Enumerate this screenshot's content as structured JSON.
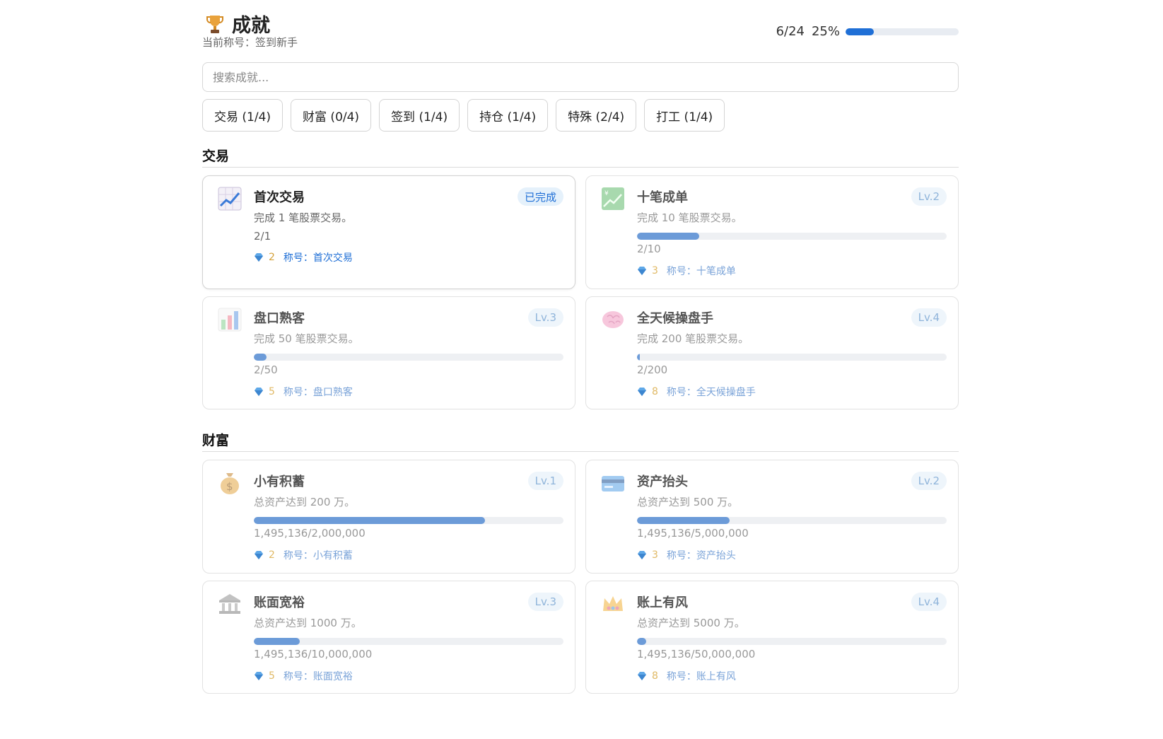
{
  "header": {
    "title": "成就",
    "current_title": "当前称号：签到新手",
    "progress_count": "6/24",
    "progress_percent": "25%",
    "progress_fraction": 0.25
  },
  "search": {
    "placeholder": "搜索成就..."
  },
  "filters": [
    {
      "label": "交易 (1/4)"
    },
    {
      "label": "财富 (0/4)"
    },
    {
      "label": "签到 (1/4)"
    },
    {
      "label": "持仓 (1/4)"
    },
    {
      "label": "特殊 (2/4)"
    },
    {
      "label": "打工 (1/4)"
    }
  ],
  "sections": [
    {
      "title": "交易",
      "cards": [
        {
          "icon": "chart-increasing-icon",
          "name": "首次交易",
          "badge": "已完成",
          "desc": "完成 1 笔股票交易。",
          "progress": "2/1",
          "fraction": 1,
          "reward": "2",
          "reward_title": "称号：首次交易",
          "completed": true
        },
        {
          "icon": "yen-chart-icon",
          "name": "十笔成单",
          "badge": "Lv.2",
          "desc": "完成 10 笔股票交易。",
          "progress": "2/10",
          "fraction": 0.2,
          "reward": "3",
          "reward_title": "称号：十笔成单",
          "completed": false
        },
        {
          "icon": "bar-chart-icon",
          "name": "盘口熟客",
          "badge": "Lv.3",
          "desc": "完成 50 笔股票交易。",
          "progress": "2/50",
          "fraction": 0.04,
          "reward": "5",
          "reward_title": "称号：盘口熟客",
          "completed": false
        },
        {
          "icon": "brain-icon",
          "name": "全天候操盘手",
          "badge": "Lv.4",
          "desc": "完成 200 笔股票交易。",
          "progress": "2/200",
          "fraction": 0.01,
          "reward": "8",
          "reward_title": "称号：全天候操盘手",
          "completed": false
        }
      ]
    },
    {
      "title": "财富",
      "cards": [
        {
          "icon": "money-bag-icon",
          "name": "小有积蓄",
          "badge": "Lv.1",
          "desc": "总资产达到 200 万。",
          "progress": "1,495,136/2,000,000",
          "fraction": 0.7476,
          "reward": "2",
          "reward_title": "称号：小有积蓄",
          "completed": false
        },
        {
          "icon": "credit-card-icon",
          "name": "资产抬头",
          "badge": "Lv.2",
          "desc": "总资产达到 500 万。",
          "progress": "1,495,136/5,000,000",
          "fraction": 0.299,
          "reward": "3",
          "reward_title": "称号：资产抬头",
          "completed": false
        },
        {
          "icon": "bank-icon",
          "name": "账面宽裕",
          "badge": "Lv.3",
          "desc": "总资产达到 1000 万。",
          "progress": "1,495,136/10,000,000",
          "fraction": 0.1495,
          "reward": "5",
          "reward_title": "称号：账面宽裕",
          "completed": false
        },
        {
          "icon": "crown-icon",
          "name": "账上有风",
          "badge": "Lv.4",
          "desc": "总资产达到 5000 万。",
          "progress": "1,495,136/50,000,000",
          "fraction": 0.0299,
          "reward": "8",
          "reward_title": "称号：账上有风",
          "completed": false
        }
      ]
    }
  ],
  "colors": {
    "accent": "#1f6fd6",
    "bar_fill": "#6c9bd8",
    "reward_gold": "#d4a13a"
  }
}
